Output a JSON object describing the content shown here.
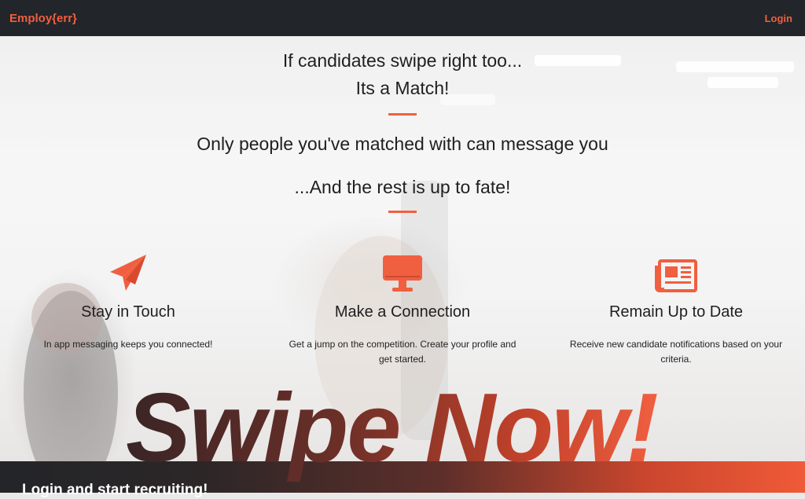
{
  "nav": {
    "brand": "Employ{err}",
    "login": "Login"
  },
  "hero": {
    "line1": "If candidates swipe right too...",
    "line2": "Its a Match!",
    "line3": "Only people you've matched with can message you",
    "line4": "...And the rest is up to fate!"
  },
  "features": [
    {
      "icon": "paper-plane-icon",
      "title": "Stay in Touch",
      "text": "In app messaging keeps you connected!"
    },
    {
      "icon": "desktop-monitor-icon",
      "title": "Make a Connection",
      "text": "Get a jump on the competition. Create your profile and get started."
    },
    {
      "icon": "newspaper-icon",
      "title": "Remain Up to Date",
      "text": "Receive new candidate notifications based on your criteria."
    }
  ],
  "swipe": "Swipe Now!",
  "band": {
    "text": "Login and start recruiting!"
  },
  "colors": {
    "accent": "#f05f40",
    "nav_bg": "#222529"
  }
}
